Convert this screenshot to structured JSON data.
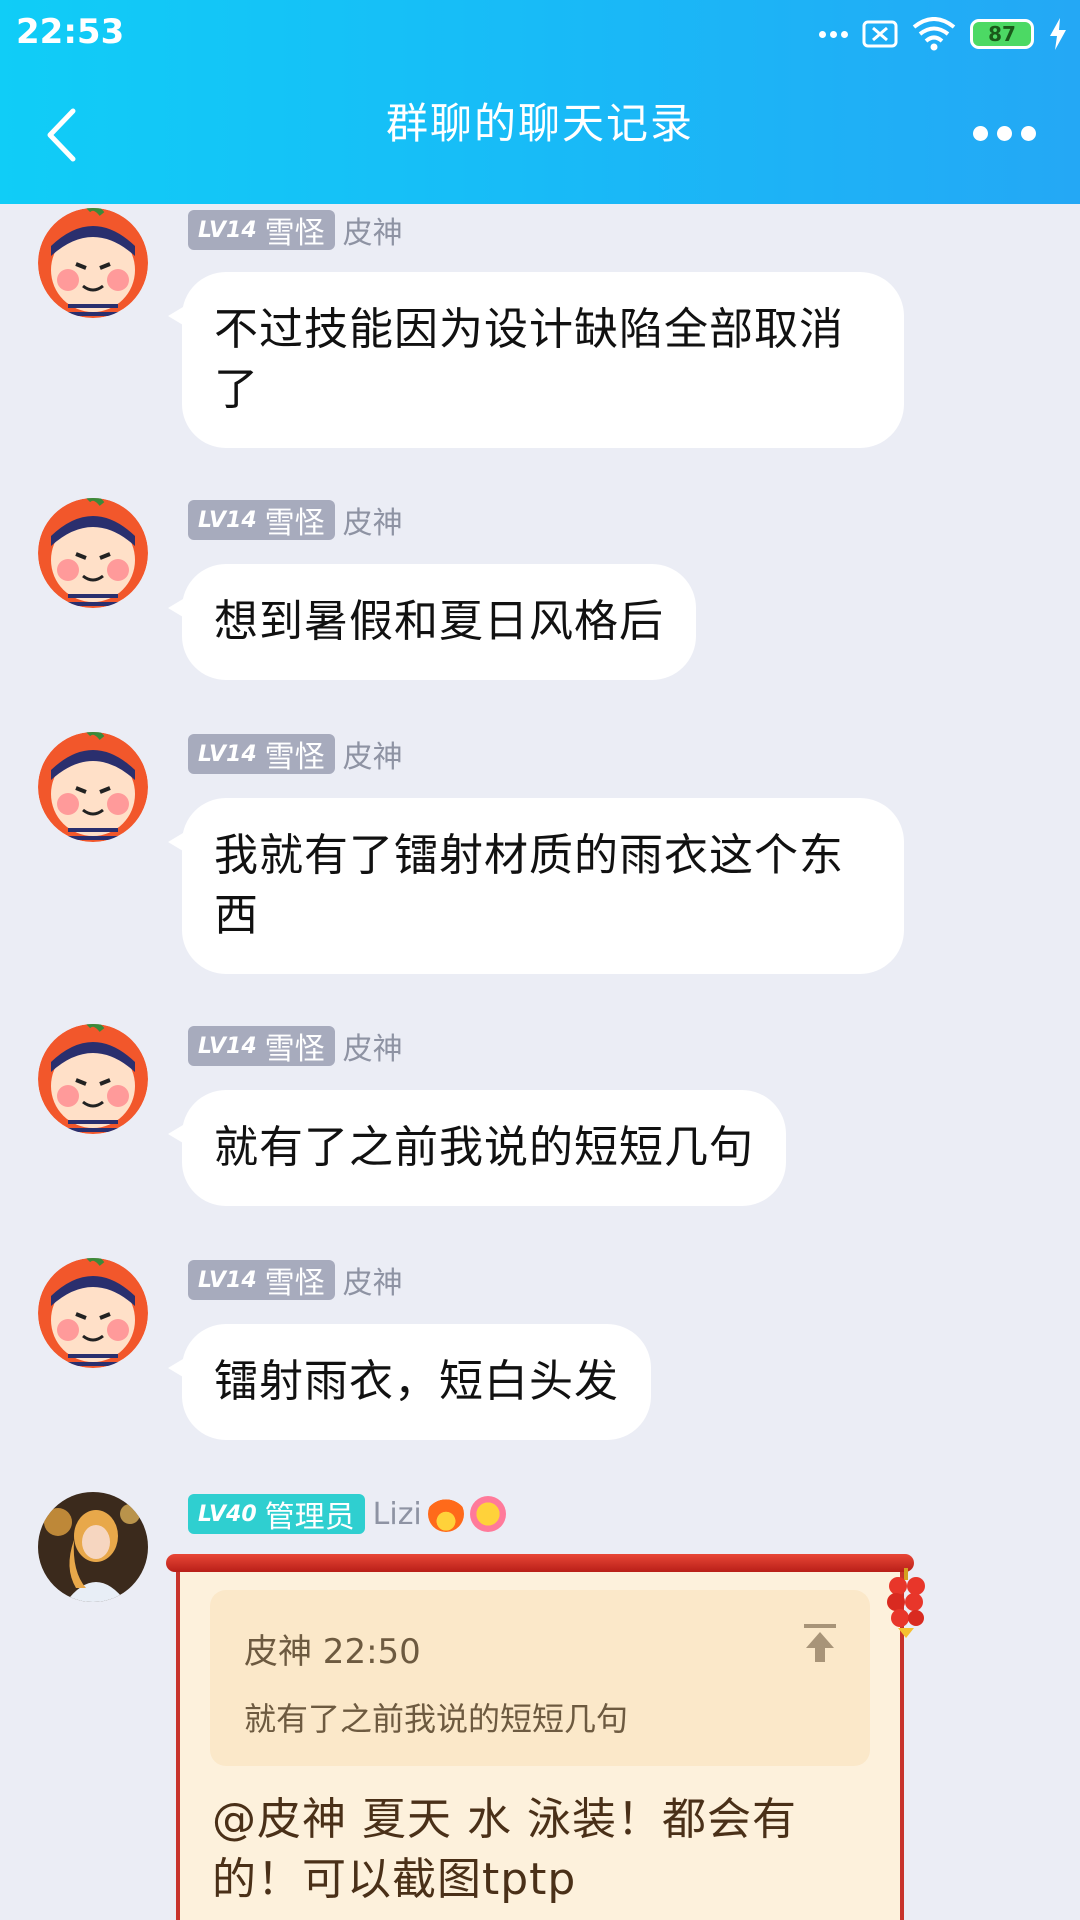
{
  "status_bar": {
    "time": "22:53",
    "battery": "87"
  },
  "header": {
    "title": "群聊的聊天记录"
  },
  "badge": {
    "level": "LV14",
    "title": "雪怪"
  },
  "sender": "皮神",
  "messages": [
    {
      "text": "不过技能因为设计缺陷全部取消了"
    },
    {
      "text": "想到暑假和夏日风格后"
    },
    {
      "text": "我就有了镭射材质的雨衣这个东西"
    },
    {
      "text": "就有了之前我说的短短几句"
    },
    {
      "text": "镭射雨衣，短白头发"
    }
  ],
  "reply_message": {
    "badge": {
      "level": "LV40",
      "title": "管理员"
    },
    "sender": "Lizi",
    "quote": {
      "author_time": "皮神 22:50",
      "text": "就有了之前我说的短短几句"
    },
    "text": "@皮神 夏天 水 泳装！都会有的！可以截图tptp"
  },
  "colors": {
    "header_start": "#10cdf7",
    "header_end": "#24a8f5",
    "background": "#ebedf5",
    "grey_tag": "#a7abbd",
    "admin_tag": "#2fcfd0"
  }
}
